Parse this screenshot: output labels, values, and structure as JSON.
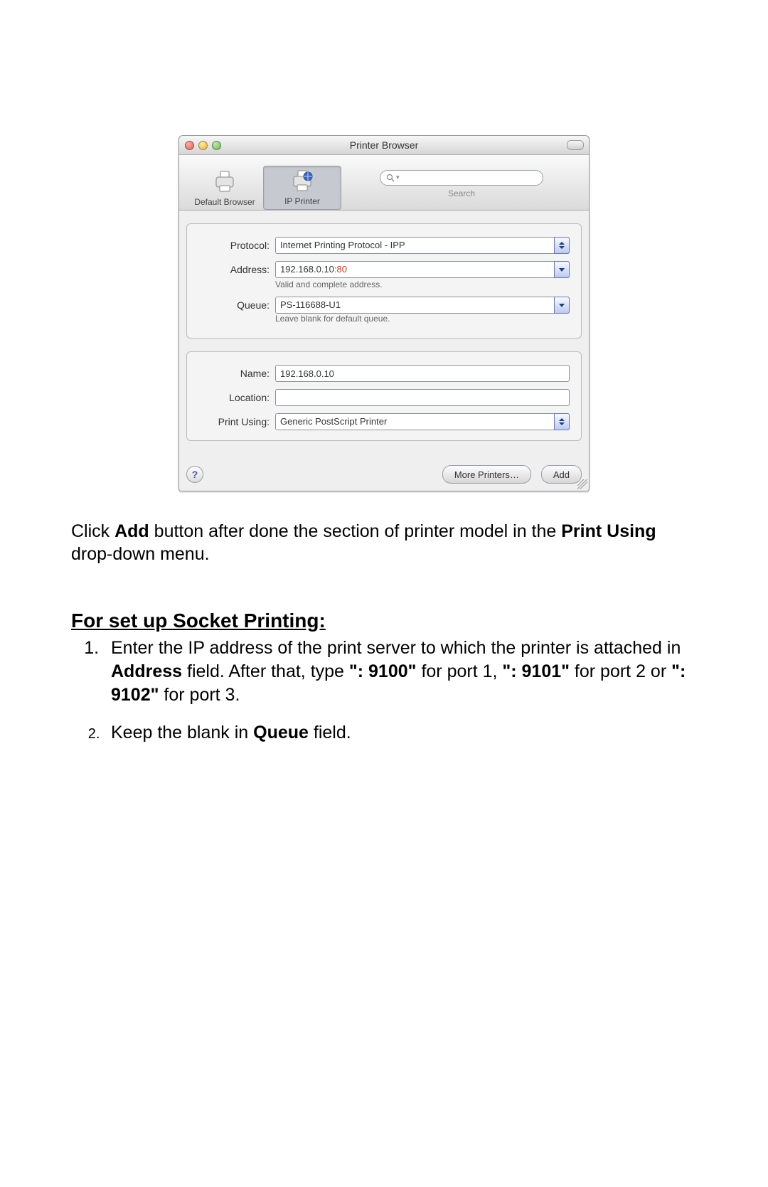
{
  "window": {
    "title": "Printer Browser",
    "toolbar": {
      "default_browser": "Default Browser",
      "ip_printer": "IP Printer",
      "search_label": "Search",
      "search_placeholder": ""
    },
    "form": {
      "protocol_label": "Protocol:",
      "protocol_value": "Internet Printing Protocol - IPP",
      "address_label": "Address:",
      "address_value_black": "192.168.0.10",
      "address_value_red": ":80",
      "address_hint": "Valid and complete address.",
      "queue_label": "Queue:",
      "queue_value": "PS-116688-U1",
      "queue_hint": "Leave blank for default queue.",
      "name_label": "Name:",
      "name_value": "192.168.0.10",
      "location_label": "Location:",
      "location_value": "",
      "print_using_label": "Print Using:",
      "print_using_value": "Generic PostScript Printer"
    },
    "footer": {
      "help": "?",
      "more_printers": "More Printers…",
      "add": "Add"
    }
  },
  "doc": {
    "p1_a": "Click ",
    "p1_b": "Add",
    "p1_c": " button after done the section of printer model in the ",
    "p1_d": "Print Using",
    "p1_e": " drop-down menu.",
    "heading": "For set up Socket Printing:",
    "s1_a": "Enter the IP address of the print server to which the printer is attached in ",
    "s1_b": "Address",
    "s1_c": " field. After that, type ",
    "s1_d": "\": 9100\"",
    "s1_e": " for port 1, ",
    "s1_f": "\": 9101\"",
    "s1_g": " for port 2 or ",
    "s1_h": "\": 9102\"",
    "s1_i": " for port 3.",
    "s2_a": "Keep the blank in ",
    "s2_b": "Queue",
    "s2_c": " field."
  }
}
